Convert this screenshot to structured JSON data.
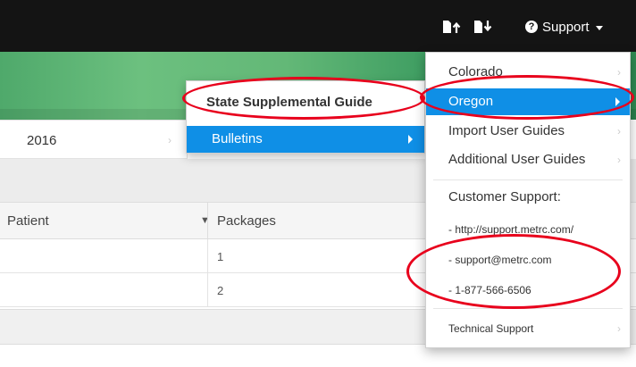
{
  "navbar": {
    "upload_icon": "file-upload-icon",
    "download_icon": "file-download-icon",
    "support_icon": "question-circle-icon",
    "support_label": "Support"
  },
  "background": {
    "year_label": "2016",
    "table_headers": [
      "Patient",
      "Packages"
    ],
    "rows": [
      "1",
      "2"
    ]
  },
  "submenu": {
    "items": [
      "State Supplemental Guide",
      "Bulletins"
    ]
  },
  "dropdown": {
    "items": [
      "Colorado",
      "Oregon",
      "Import User Guides",
      "Additional User Guides"
    ],
    "customer_support_header": "Customer Support:",
    "contact_lines": [
      "- http://support.metrc.com/",
      "- support@metrc.com",
      "- 1-877-566-6506"
    ],
    "technical_support": "Technical Support"
  },
  "colors": {
    "navbar": "#141414",
    "highlight": "#0f8fe6",
    "annotation": "#e8001c"
  }
}
